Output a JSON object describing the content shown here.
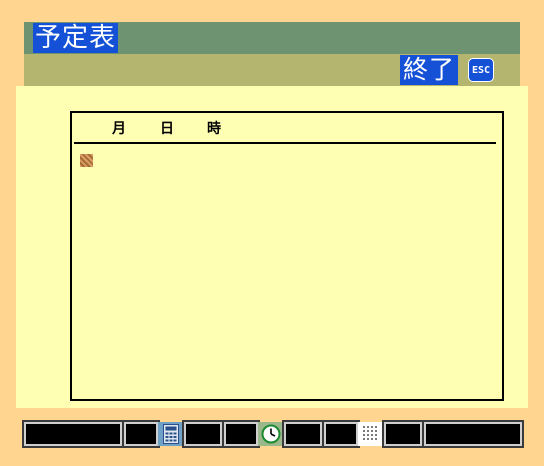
{
  "window": {
    "title": "予定表",
    "end_label": "終了",
    "esc_label": "ESC"
  },
  "table": {
    "columns": [
      "月",
      "日",
      "時"
    ]
  },
  "colors": {
    "page_bg": "#ffd58f",
    "title_band": "#6e9370",
    "sub_band": "#b4b56e",
    "panel_bg": "#ffffb4",
    "highlight": "#1451d6"
  },
  "dock": {
    "icons": [
      "calculator-icon",
      "clock-icon",
      "calendar-icon"
    ]
  }
}
